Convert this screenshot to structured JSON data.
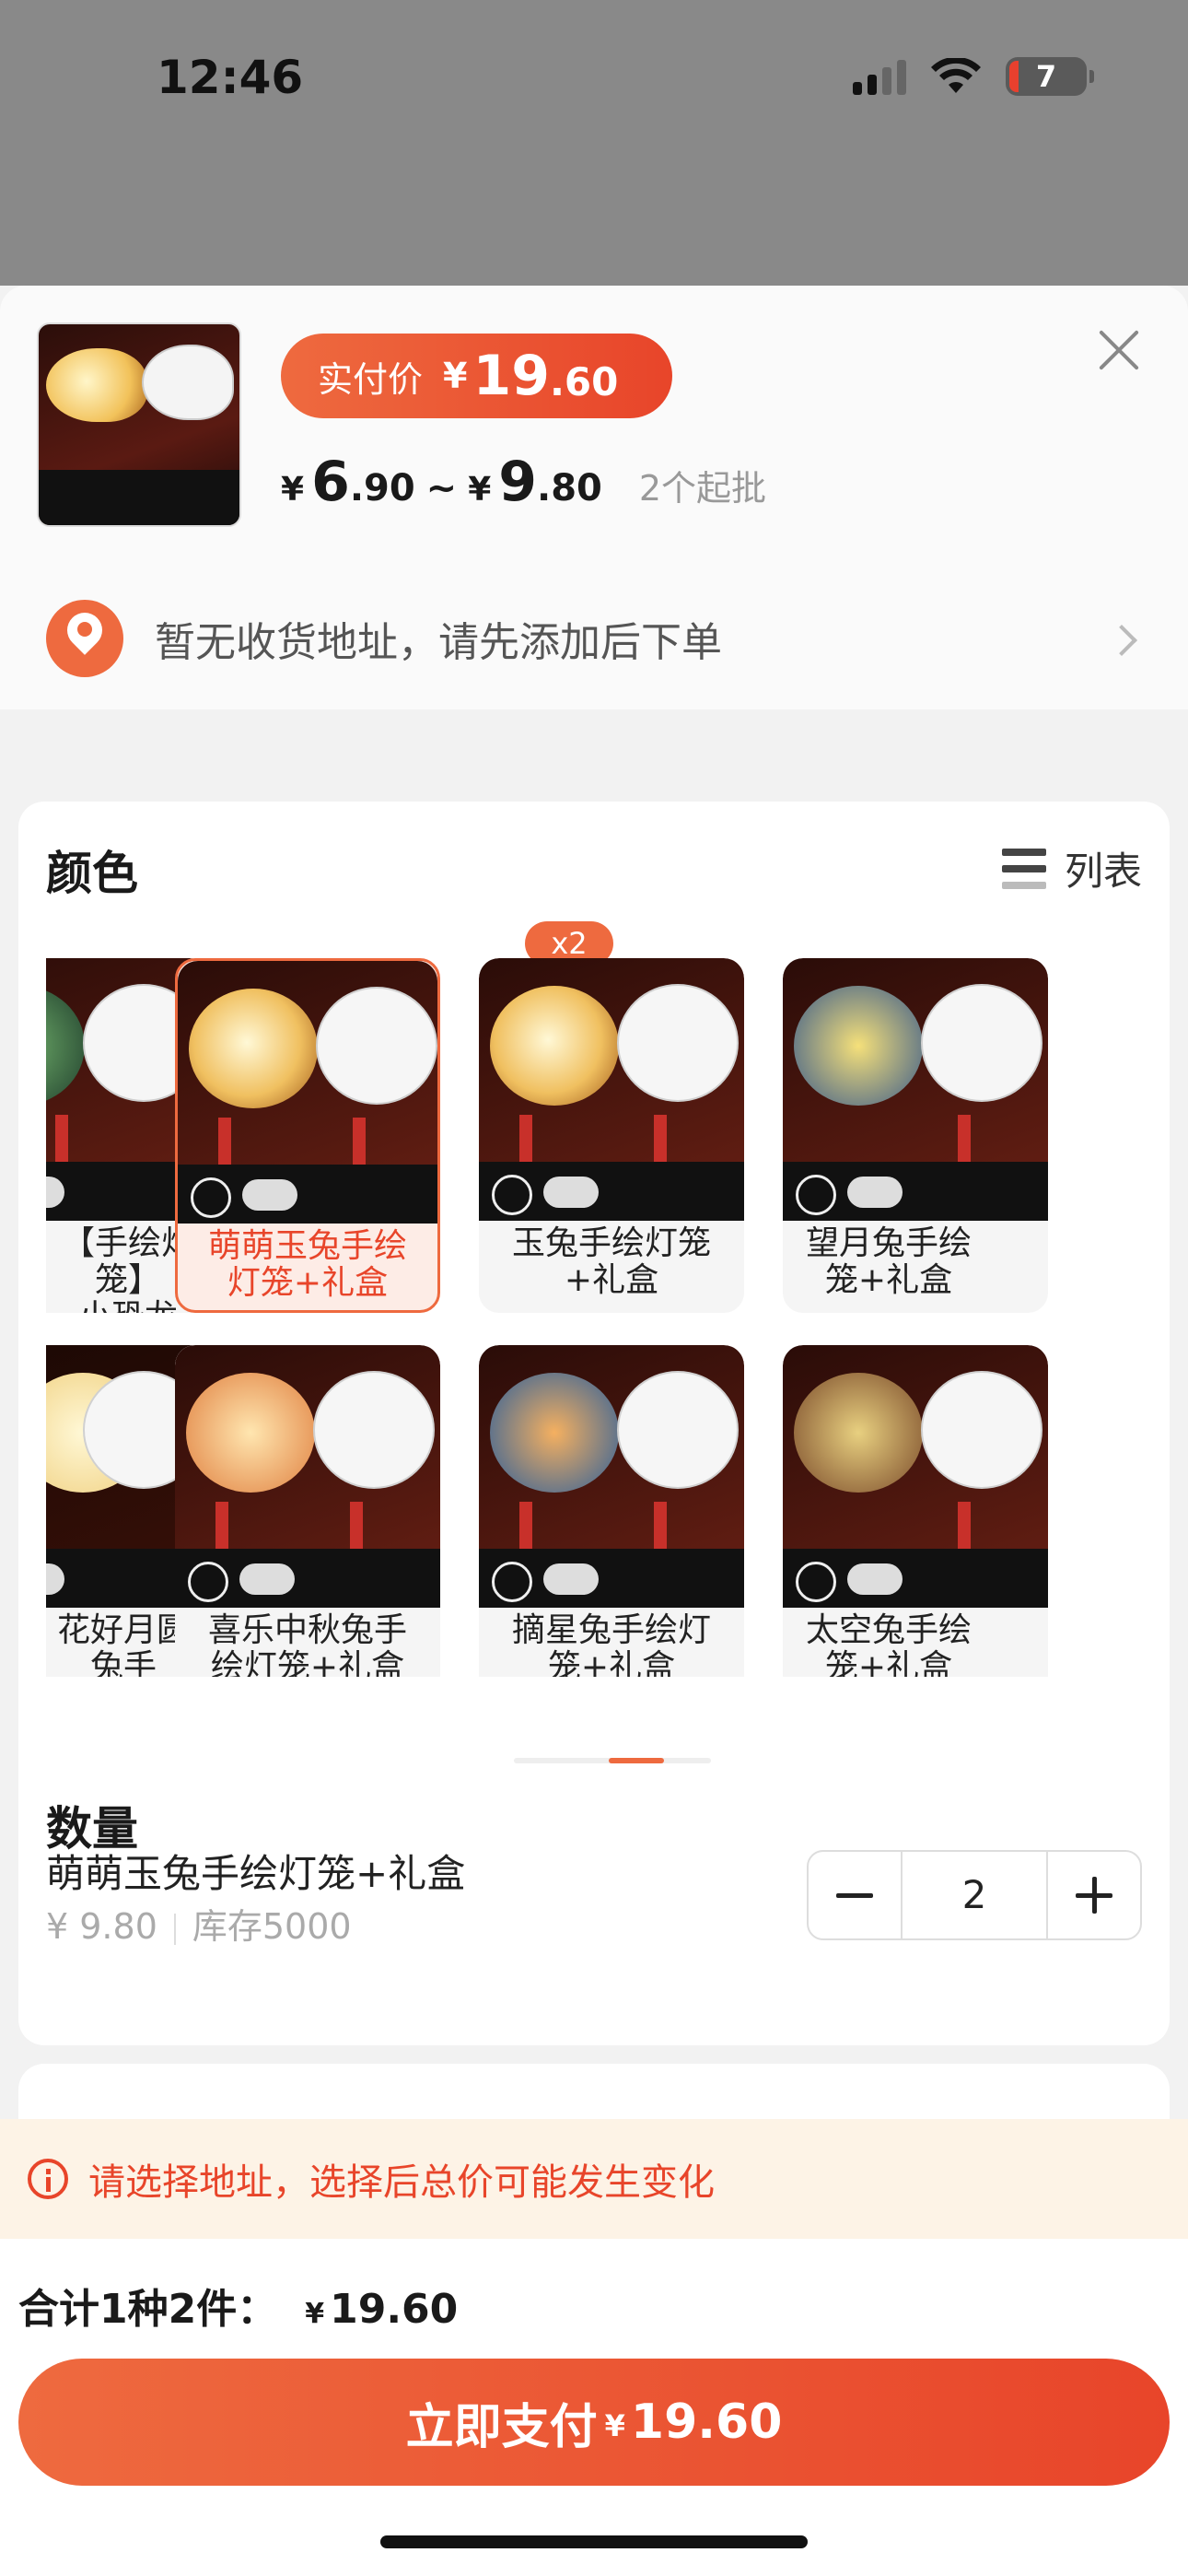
{
  "status_bar": {
    "time": "12:46",
    "battery": "7"
  },
  "header": {
    "pay_label": "实付价",
    "pay_currency": "¥",
    "pay_int": "19",
    "pay_dec": ".60",
    "range_cur1": "¥",
    "range_int1": "6",
    "range_dec1": ".90",
    "range_sep": "~",
    "range_cur2": "¥",
    "range_int2": "9",
    "range_dec2": ".80",
    "moq": "2个起批"
  },
  "address": {
    "text": "暂无收货地址，请先添加后下单"
  },
  "color_section": {
    "title": "颜色",
    "list_label": "列表",
    "items": [
      {
        "label": "【手绘灯笼】\n小恐龙"
      },
      {
        "label": "萌萌玉兔手绘\n灯笼+礼盒",
        "badge": "x2"
      },
      {
        "label": "玉兔手绘灯笼\n+礼盒"
      },
      {
        "label": "望月兔手绘\n笼+礼盒"
      },
      {
        "label": "花好月圆兔手\n绘灯笼+礼盒"
      },
      {
        "label": "喜乐中秋兔手\n绘灯笼+礼盒"
      },
      {
        "label": "摘星兔手绘灯\n笼+礼盒"
      },
      {
        "label": "太空兔手绘\n笼+礼盒"
      }
    ]
  },
  "quantity_section": {
    "title": "数量",
    "item_name": "萌萌玉兔手绘灯笼+礼盒",
    "price": "¥ 9.80",
    "stock": "库存5000",
    "value": "2"
  },
  "notice": {
    "text": "请选择地址，选择后总价可能发生变化"
  },
  "footer": {
    "total_label": "合计1种2件：",
    "total_currency": "¥",
    "total_amount": "19.60",
    "pay_button_text": "立即支付",
    "pay_button_currency": "¥",
    "pay_button_amount": "19.60"
  },
  "colors": {
    "accent": "#ee6a3f",
    "accent_dark": "#e8452a",
    "notice_bg": "#fdf3e6"
  }
}
